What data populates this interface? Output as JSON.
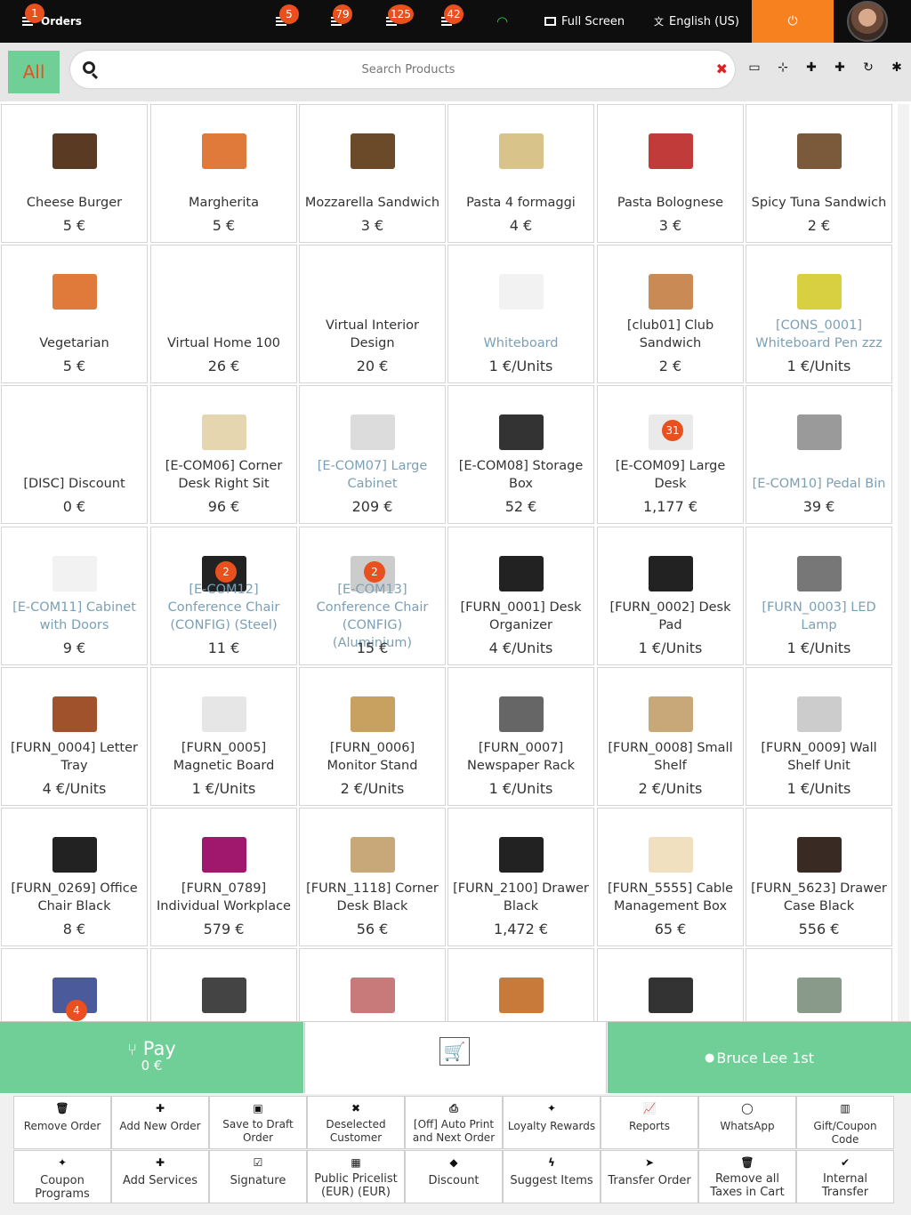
{
  "topbar": {
    "orders_label": "Orders",
    "orders_badge": "1",
    "badges": [
      "5",
      "79",
      "125",
      "42"
    ],
    "fullscreen_label": "Full Screen",
    "language_label": "English (US)",
    "power_glyph": "⏻",
    "wifi_color": "#2ecc40"
  },
  "search": {
    "all_label": "All",
    "placeholder": "Search Products",
    "clear_glyph": "✖"
  },
  "products": [
    {
      "name": "Cheese Burger",
      "price": "5 €"
    },
    {
      "name": "Margherita",
      "price": "5 €"
    },
    {
      "name": "Mozzarella Sandwich",
      "price": "3 €"
    },
    {
      "name": "Pasta 4 formaggi",
      "price": "4 €"
    },
    {
      "name": "Pasta Bolognese",
      "price": "3 €"
    },
    {
      "name": "Spicy Tuna Sandwich",
      "price": "2 €"
    },
    {
      "name": "Vegetarian",
      "price": "5 €"
    },
    {
      "name": "Virtual Home 100",
      "price": "26 €"
    },
    {
      "name": "Virtual Interior Design",
      "price": "20 €"
    },
    {
      "name": "Whiteboard",
      "price": "1 €/Units"
    },
    {
      "name": "[club01] Club Sandwich",
      "price": "2 €"
    },
    {
      "name": "[CONS_0001] Whiteboard Pen zzz",
      "price": "1 €/Units"
    },
    {
      "name": "[DISC] Discount",
      "price": "0 €"
    },
    {
      "name": "[E-COM06] Corner Desk Right Sit",
      "price": "96 €"
    },
    {
      "name": "[E-COM07] Large Cabinet",
      "price": "209 €"
    },
    {
      "name": "[E-COM08] Storage Box",
      "price": "52 €"
    },
    {
      "name": "[E-COM09] Large Desk",
      "price": "1,177 €",
      "badge": "31"
    },
    {
      "name": "[E-COM10] Pedal Bin",
      "price": "39 €"
    },
    {
      "name": "[E-COM11] Cabinet with Doors",
      "price": "9 €"
    },
    {
      "name": "[E-COM12] Conference Chair (CONFIG) (Steel)",
      "price": "11 €",
      "badge": "2"
    },
    {
      "name": "[E-COM13] Conference Chair (CONFIG) (Aluminium)",
      "price": "15 €",
      "badge": "2"
    },
    {
      "name": "[FURN_0001] Desk Organizer",
      "price": "4 €/Units"
    },
    {
      "name": "[FURN_0002] Desk Pad",
      "price": "1 €/Units"
    },
    {
      "name": "[FURN_0003] LED Lamp",
      "price": "1 €/Units"
    },
    {
      "name": "[FURN_0004] Letter Tray",
      "price": "4 €/Units"
    },
    {
      "name": "[FURN_0005] Magnetic Board",
      "price": "1 €/Units"
    },
    {
      "name": "[FURN_0006] Monitor Stand",
      "price": "2 €/Units"
    },
    {
      "name": "[FURN_0007] Newspaper Rack",
      "price": "1 €/Units"
    },
    {
      "name": "[FURN_0008] Small Shelf",
      "price": "2 €/Units"
    },
    {
      "name": "[FURN_0009] Wall Shelf Unit",
      "price": "1 €/Units"
    },
    {
      "name": "[FURN_0269] Office Chair Black",
      "price": "8 €"
    },
    {
      "name": "[FURN_0789] Individual Workplace",
      "price": "579 €"
    },
    {
      "name": "[FURN_1118] Corner Desk Black",
      "price": "56 €"
    },
    {
      "name": "[FURN_2100] Drawer Black",
      "price": "1,472 €"
    },
    {
      "name": "[FURN_5555] Cable Management Box",
      "price": "65 €"
    },
    {
      "name": "[FURN_5623] Drawer Case Black",
      "price": "556 €"
    },
    {
      "name": "",
      "price": "",
      "badge": "4"
    },
    {
      "name": "",
      "price": ""
    },
    {
      "name": "",
      "price": ""
    },
    {
      "name": "",
      "price": ""
    },
    {
      "name": "",
      "price": ""
    },
    {
      "name": "",
      "price": ""
    }
  ],
  "pay": {
    "label": "Pay",
    "amount": "0 €",
    "customer": "Bruce Lee 1st"
  },
  "actions_row1": [
    {
      "label": "Remove Order",
      "icon": "trash-icon",
      "glyph": "🗑"
    },
    {
      "label": "Add New Order",
      "icon": "plus-icon",
      "glyph": "✚"
    },
    {
      "label": "Save to Draft Order",
      "icon": "save-icon",
      "glyph": "▣"
    },
    {
      "label": "Deselected Customer",
      "icon": "user-x-icon",
      "glyph": "✖"
    },
    {
      "label": "[Off] Auto Print and Next Order",
      "icon": "print-icon",
      "glyph": "⎙"
    },
    {
      "label": "Loyalty Rewards",
      "icon": "gift-icon",
      "glyph": "✦"
    },
    {
      "label": "Reports",
      "icon": "chart-icon",
      "glyph": "📈"
    },
    {
      "label": "WhatsApp",
      "icon": "whatsapp-icon",
      "glyph": "◯"
    },
    {
      "label": "Gift/Coupon Code",
      "icon": "barcode-icon",
      "glyph": "▥"
    }
  ],
  "actions_row2": [
    {
      "label": "Coupon Programs",
      "icon": "gift-icon",
      "glyph": "✦"
    },
    {
      "label": "Add Services",
      "icon": "plus-icon",
      "glyph": "✚"
    },
    {
      "label": "Signature",
      "icon": "check-square-icon",
      "glyph": "☑"
    },
    {
      "label": "Public Pricelist (EUR) (EUR)",
      "icon": "grid-icon",
      "glyph": "▦"
    },
    {
      "label": "Discount",
      "icon": "tag-icon",
      "glyph": "◆"
    },
    {
      "label": "Suggest Items",
      "icon": "bolt-icon",
      "glyph": "ϟ"
    },
    {
      "label": "Transfer Order",
      "icon": "send-icon",
      "glyph": "➤"
    },
    {
      "label": "Remove all Taxes in Cart",
      "icon": "trash-icon",
      "glyph": "🗑"
    },
    {
      "label": "Internal Transfer",
      "icon": "check-icon",
      "glyph": "✔"
    }
  ]
}
